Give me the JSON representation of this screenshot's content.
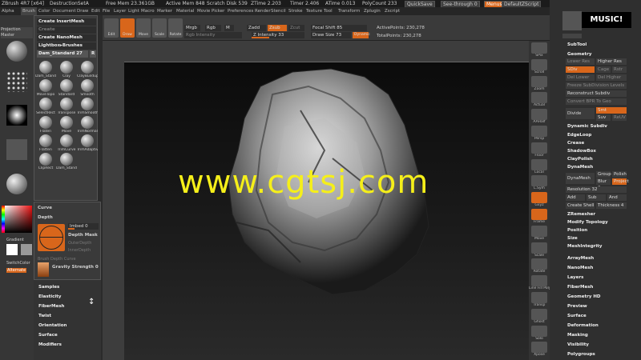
{
  "titlebar": {
    "app": "ZBrush 4R7 [x64]",
    "project": "DestructionSetA",
    "free_mem": "Free Mem 23.361GB",
    "active_mem": "Active Mem 848",
    "scratch_disk": "Scratch Disk 539",
    "ztime": "ZTime 2.203",
    "timer": "Timer 2.406",
    "atime": "ATime 0.013",
    "polycount": "PolyCount 233",
    "quicksave": "QuickSave",
    "seethrough": "See-through 0",
    "menus": "Menus",
    "defaultzscript": "DefaultZScript"
  },
  "menubar": [
    "Alpha",
    "Brush",
    "Color",
    "Document",
    "Draw",
    "Edit",
    "File",
    "Layer",
    "Light",
    "Macro",
    "Marker",
    "Material",
    "Movie",
    "Picker",
    "Preferences",
    "Render",
    "Stencil",
    "Stroke",
    "Texture",
    "Tool",
    "Transform",
    "Zplugin",
    "Zscript"
  ],
  "shelf": {
    "edit": "Edit",
    "draw": "Draw",
    "move": "Move",
    "scale": "Scale",
    "rotate": "Rotate",
    "mrgb": "Mrgb",
    "rgb": "Rgb",
    "m": "M",
    "rgb_intensity": "Rgb Intensity",
    "zadd": "Zadd",
    "zsub": "Zsub",
    "zcut": "Zcut",
    "z_intensity": "Z Intensity 33",
    "z_intensity_value": 33,
    "focal_shift": "Focal Shift 85",
    "draw_size": "Draw Size 73",
    "dynamic": "Dynamic",
    "active_points": "ActivePoints: 230,278",
    "total_points": "TotalPoints: 230,278"
  },
  "leftcol": {
    "projection_master": "Projection Master",
    "gradient": "Gradient",
    "switch_color": "SwitchColor",
    "alternate": "Alternate"
  },
  "brush_popup": {
    "create_insert": "Create InsertMesh",
    "create_insert_multi": "Create InsertMultiMesh",
    "create_nanomesh": "Create NanoMesh Brush",
    "lightbox": "Lightbox▸Brushes",
    "current": "Dam_Standard  27",
    "r": "R",
    "brushes": [
      "Dam_Standard",
      "Clay",
      "ClayBuildup",
      "MoveTopo",
      "Standard",
      "Smooth",
      "SelectRect",
      "Transpose",
      "TrimSmoothBorder",
      "Flaten",
      "Move",
      "TrimNormal",
      "Flatten",
      "TrimCurve",
      "TrimAdaptive",
      "ClipRect",
      "Dam_Standard"
    ]
  },
  "material_panel": {
    "curve": "Curve",
    "depth": "Depth",
    "imbed": "Imbed 0",
    "depth_mask": "Depth Mask",
    "outer_depth": "OuterDepth",
    "inner_depth": "InnerDepth",
    "brush_depth_curve": "Brush Depth Curve",
    "gravity": "Gravity Strength 0"
  },
  "lower_list": [
    "Samples",
    "Elasticity",
    "FiberMesh",
    "Twist",
    "Orientation",
    "Surface",
    "Modifiers"
  ],
  "right_toolbar": [
    "SPix",
    "Scroll",
    "Zoom",
    "Actual",
    "AAHalf",
    "Persp",
    "Floor",
    "Local",
    "L.Sym",
    "Gxyz",
    "Frame",
    "Move",
    "Scale",
    "Rotate",
    "Line Fill PolyF",
    "Transp",
    "Ghost",
    "Solo",
    "Xpose"
  ],
  "right_palette": {
    "music": "MUSIC!",
    "subtool": "SubTool",
    "geometry": "Geometry",
    "lower_res": "Lower Res",
    "higher_res": "Higher Res",
    "sdiv": "SDiv",
    "cage": "Cage",
    "rstr": "Rstr",
    "del_lower": "Del Lower",
    "del_higher": "Del Higher",
    "freeze_subdiv": "Freeze SubDivision Levels",
    "reconstruct": "Reconstruct Subdiv",
    "convert_bpr": "Convert BPR To Geo",
    "divide": "Divide",
    "smt": "Smt",
    "suv": "Suv",
    "rsmt": "ReUV",
    "dynamic_subdiv": "Dynamic Subdiv",
    "edgeloop": "EdgeLoop",
    "crease": "Crease",
    "shadowbox": "ShadowBox",
    "claypolish": "ClayPolish",
    "dynamesh": "DynaMesh",
    "dynamesh_btn": "DynaMesh",
    "group": "Group",
    "polish": "Polish",
    "blur": "Blur 0",
    "project": "Project",
    "resolution": "Resolution 32",
    "add": "Add",
    "sub": "Sub",
    "and": "And",
    "create_shell": "Create Shell",
    "thickness": "Thickness 4",
    "zremesher": "ZRemesher",
    "modify_topology": "Modify Topology",
    "position": "Position",
    "size": "Size",
    "meshintegrity": "MeshIntegrity",
    "arraymesh": "ArrayMesh",
    "nanomesh": "NanoMesh",
    "layers": "Layers",
    "fibermesh": "FiberMesh",
    "geometry_hd": "Geometry HD",
    "preview": "Preview",
    "surface": "Surface",
    "deformation": "Deformation",
    "masking": "Masking",
    "visibility": "Visibility",
    "polygroups": "Polygroups"
  },
  "watermark": "www.cgtsj.com",
  "colors": {
    "accent": "#d8661b",
    "watermark": "#f5ef1a"
  }
}
